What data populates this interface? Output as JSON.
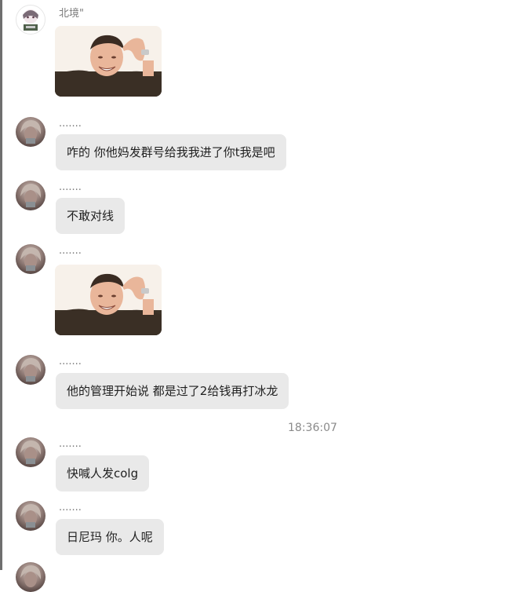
{
  "messages": [
    {
      "sender": "北境\"",
      "type": "sticker",
      "sticker_icon": "laughing-man-sticker"
    },
    {
      "sender": ".......",
      "type": "text",
      "text": "咋的 你他妈发群号给我我进了你t我是吧"
    },
    {
      "sender": ".......",
      "type": "text",
      "text": "不敢对线"
    },
    {
      "sender": ".......",
      "type": "sticker",
      "sticker_icon": "laughing-man-sticker"
    },
    {
      "sender": ".......",
      "type": "text",
      "text": "他的管理开始说 都是过了2给钱再打冰龙"
    },
    {
      "timestamp": "18:36:07"
    },
    {
      "sender": ".......",
      "type": "text",
      "text": "快喊人发colg"
    },
    {
      "sender": ".......",
      "type": "text",
      "text": "日尼玛  你。人呢"
    }
  ]
}
